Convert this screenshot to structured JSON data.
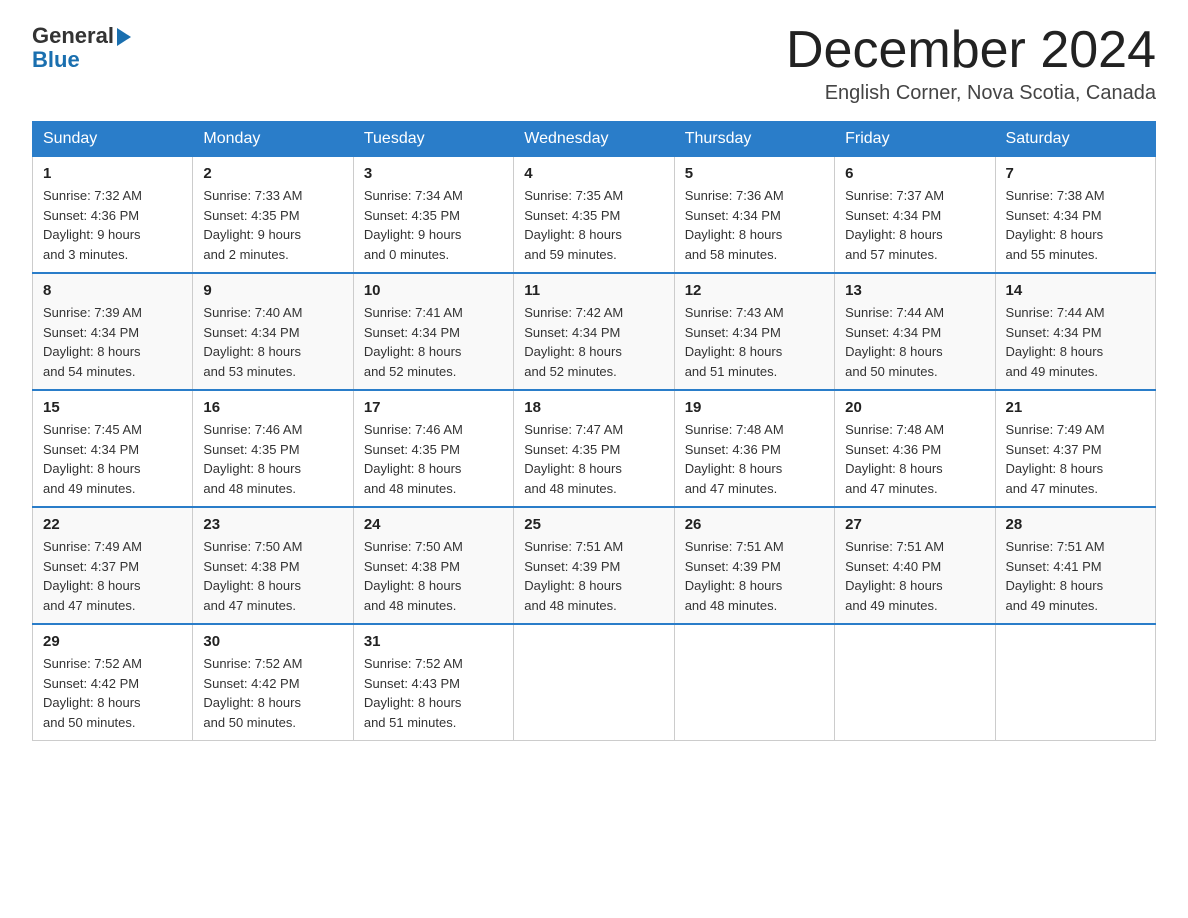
{
  "header": {
    "logo_text": "General",
    "logo_blue": "Blue",
    "month": "December 2024",
    "location": "English Corner, Nova Scotia, Canada"
  },
  "weekdays": [
    "Sunday",
    "Monday",
    "Tuesday",
    "Wednesday",
    "Thursday",
    "Friday",
    "Saturday"
  ],
  "weeks": [
    [
      {
        "day": "1",
        "sunrise": "7:32 AM",
        "sunset": "4:36 PM",
        "daylight": "9 hours and 3 minutes."
      },
      {
        "day": "2",
        "sunrise": "7:33 AM",
        "sunset": "4:35 PM",
        "daylight": "9 hours and 2 minutes."
      },
      {
        "day": "3",
        "sunrise": "7:34 AM",
        "sunset": "4:35 PM",
        "daylight": "9 hours and 0 minutes."
      },
      {
        "day": "4",
        "sunrise": "7:35 AM",
        "sunset": "4:35 PM",
        "daylight": "8 hours and 59 minutes."
      },
      {
        "day": "5",
        "sunrise": "7:36 AM",
        "sunset": "4:34 PM",
        "daylight": "8 hours and 58 minutes."
      },
      {
        "day": "6",
        "sunrise": "7:37 AM",
        "sunset": "4:34 PM",
        "daylight": "8 hours and 57 minutes."
      },
      {
        "day": "7",
        "sunrise": "7:38 AM",
        "sunset": "4:34 PM",
        "daylight": "8 hours and 55 minutes."
      }
    ],
    [
      {
        "day": "8",
        "sunrise": "7:39 AM",
        "sunset": "4:34 PM",
        "daylight": "8 hours and 54 minutes."
      },
      {
        "day": "9",
        "sunrise": "7:40 AM",
        "sunset": "4:34 PM",
        "daylight": "8 hours and 53 minutes."
      },
      {
        "day": "10",
        "sunrise": "7:41 AM",
        "sunset": "4:34 PM",
        "daylight": "8 hours and 52 minutes."
      },
      {
        "day": "11",
        "sunrise": "7:42 AM",
        "sunset": "4:34 PM",
        "daylight": "8 hours and 52 minutes."
      },
      {
        "day": "12",
        "sunrise": "7:43 AM",
        "sunset": "4:34 PM",
        "daylight": "8 hours and 51 minutes."
      },
      {
        "day": "13",
        "sunrise": "7:44 AM",
        "sunset": "4:34 PM",
        "daylight": "8 hours and 50 minutes."
      },
      {
        "day": "14",
        "sunrise": "7:44 AM",
        "sunset": "4:34 PM",
        "daylight": "8 hours and 49 minutes."
      }
    ],
    [
      {
        "day": "15",
        "sunrise": "7:45 AM",
        "sunset": "4:34 PM",
        "daylight": "8 hours and 49 minutes."
      },
      {
        "day": "16",
        "sunrise": "7:46 AM",
        "sunset": "4:35 PM",
        "daylight": "8 hours and 48 minutes."
      },
      {
        "day": "17",
        "sunrise": "7:46 AM",
        "sunset": "4:35 PM",
        "daylight": "8 hours and 48 minutes."
      },
      {
        "day": "18",
        "sunrise": "7:47 AM",
        "sunset": "4:35 PM",
        "daylight": "8 hours and 48 minutes."
      },
      {
        "day": "19",
        "sunrise": "7:48 AM",
        "sunset": "4:36 PM",
        "daylight": "8 hours and 47 minutes."
      },
      {
        "day": "20",
        "sunrise": "7:48 AM",
        "sunset": "4:36 PM",
        "daylight": "8 hours and 47 minutes."
      },
      {
        "day": "21",
        "sunrise": "7:49 AM",
        "sunset": "4:37 PM",
        "daylight": "8 hours and 47 minutes."
      }
    ],
    [
      {
        "day": "22",
        "sunrise": "7:49 AM",
        "sunset": "4:37 PM",
        "daylight": "8 hours and 47 minutes."
      },
      {
        "day": "23",
        "sunrise": "7:50 AM",
        "sunset": "4:38 PM",
        "daylight": "8 hours and 47 minutes."
      },
      {
        "day": "24",
        "sunrise": "7:50 AM",
        "sunset": "4:38 PM",
        "daylight": "8 hours and 48 minutes."
      },
      {
        "day": "25",
        "sunrise": "7:51 AM",
        "sunset": "4:39 PM",
        "daylight": "8 hours and 48 minutes."
      },
      {
        "day": "26",
        "sunrise": "7:51 AM",
        "sunset": "4:39 PM",
        "daylight": "8 hours and 48 minutes."
      },
      {
        "day": "27",
        "sunrise": "7:51 AM",
        "sunset": "4:40 PM",
        "daylight": "8 hours and 49 minutes."
      },
      {
        "day": "28",
        "sunrise": "7:51 AM",
        "sunset": "4:41 PM",
        "daylight": "8 hours and 49 minutes."
      }
    ],
    [
      {
        "day": "29",
        "sunrise": "7:52 AM",
        "sunset": "4:42 PM",
        "daylight": "8 hours and 50 minutes."
      },
      {
        "day": "30",
        "sunrise": "7:52 AM",
        "sunset": "4:42 PM",
        "daylight": "8 hours and 50 minutes."
      },
      {
        "day": "31",
        "sunrise": "7:52 AM",
        "sunset": "4:43 PM",
        "daylight": "8 hours and 51 minutes."
      },
      null,
      null,
      null,
      null
    ]
  ],
  "labels": {
    "sunrise": "Sunrise:",
    "sunset": "Sunset:",
    "daylight": "Daylight:"
  }
}
